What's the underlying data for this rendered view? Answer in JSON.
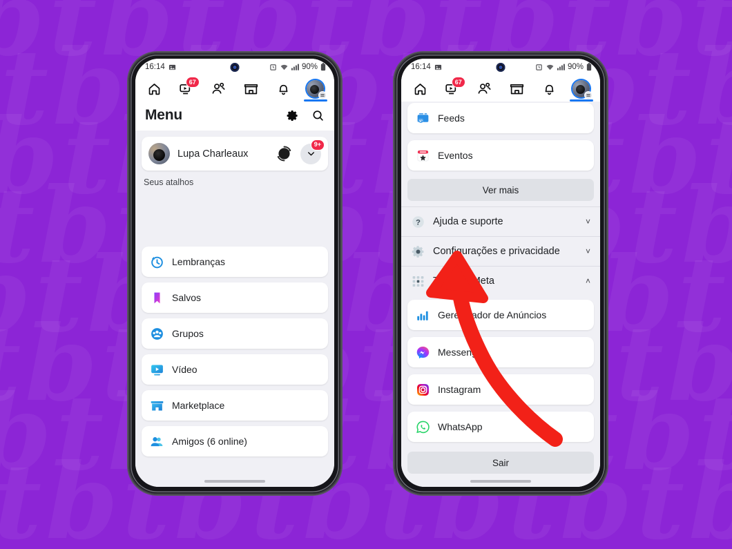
{
  "background": {
    "color": "#8c25d6",
    "watermark_text": "btbtbtbtbtbtb"
  },
  "annotation": {
    "arrow_color": "#f22118",
    "arrow_points_at": "Tudo da Meta"
  },
  "status_bar": {
    "time": "16:14",
    "left_icon": "screenshot-icon",
    "battery_percent": "90%",
    "icons": [
      "alarm-icon",
      "wifi-icon",
      "signal-icon",
      "battery-icon"
    ]
  },
  "top_nav": {
    "items": [
      {
        "name": "home-icon",
        "badge": ""
      },
      {
        "name": "reels-icon",
        "badge": "67"
      },
      {
        "name": "friends-icon",
        "badge": ""
      },
      {
        "name": "marketplace-icon",
        "badge": ""
      },
      {
        "name": "notifications-bell-icon",
        "badge": ""
      },
      {
        "name": "profile-avatar",
        "badge": ""
      }
    ],
    "active_index": 5
  },
  "phone_left": {
    "header": {
      "title": "Menu",
      "icons": [
        "gear-icon",
        "search-icon"
      ]
    },
    "profile": {
      "name": "Lupa Charleaux",
      "switch_icon": "account-switch-icon",
      "chevron_icon": "chevron-down-icon",
      "chevron_badge": "9+"
    },
    "shortcuts_label": "Seus atalhos",
    "menu_items": [
      {
        "label": "Lembranças",
        "icon": "memories-clock-icon",
        "color": "#1e8fe0"
      },
      {
        "label": "Salvos",
        "icon": "saved-bookmark-icon",
        "color": "#c838e0"
      },
      {
        "label": "Grupos",
        "icon": "groups-icon",
        "color": "#1e8fe0"
      },
      {
        "label": "Vídeo",
        "icon": "video-icon",
        "color": "#26aee8"
      },
      {
        "label": "Marketplace",
        "icon": "marketplace-store-icon",
        "color": "#2aa8ea"
      },
      {
        "label": "Amigos (6 online)",
        "icon": "friends-filled-icon",
        "color": "#1e8fe0"
      }
    ]
  },
  "phone_right": {
    "top_items": [
      {
        "label": "Feeds",
        "icon": "feeds-icon",
        "color": "#2b8fe5"
      },
      {
        "label": "Eventos",
        "icon": "events-calendar-icon",
        "color": "#f0274b"
      }
    ],
    "see_more_label": "Ver mais",
    "expandables": [
      {
        "label": "Ajuda e suporte",
        "icon": "help-question-icon",
        "chevron": "˅",
        "expanded": false
      },
      {
        "label": "Configurações e privacidade",
        "icon": "settings-gear-icon",
        "chevron": "˅",
        "expanded": false
      },
      {
        "label": "Tudo da Meta",
        "icon": "meta-grid-icon",
        "chevron": "˄",
        "expanded": true
      }
    ],
    "meta_apps": [
      {
        "label": "Gerenciador de Anúncios",
        "icon": "ads-manager-chart-icon",
        "color": "#1e8fe0"
      },
      {
        "label": "Messenger",
        "icon": "messenger-icon",
        "color": "#a334f5"
      },
      {
        "label": "Instagram",
        "icon": "instagram-icon",
        "color": "#e1306c"
      },
      {
        "label": "WhatsApp",
        "icon": "whatsapp-icon",
        "color": "#25d366"
      }
    ],
    "logout_label": "Sair"
  }
}
